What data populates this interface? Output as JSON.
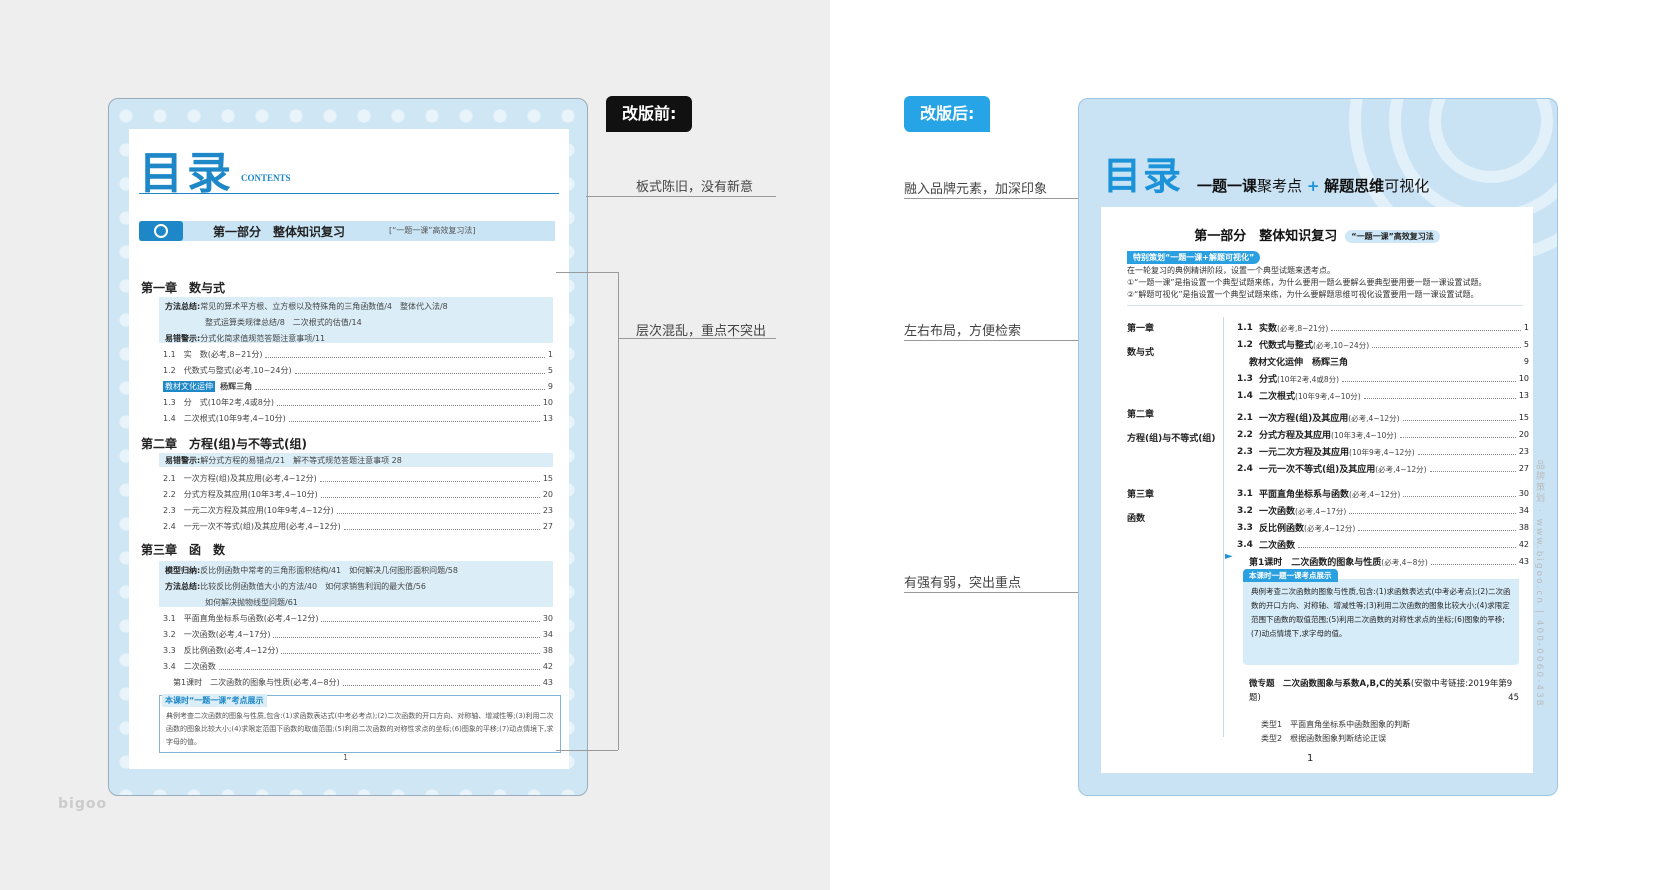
{
  "before": {
    "bubble": "改版前:",
    "notes": [
      "板式陈旧，没有新意",
      "层次混乱，重点不突出"
    ],
    "title": "目录",
    "contents": "CONTENTS",
    "part_title": "第一部分　整体知识复习",
    "part_sub": "[“一题一课”高效复习法]",
    "ch1": {
      "title": "第一章　数与式",
      "lines": [
        {
          "label": "方法总结:",
          "text": "常见的算术平方根、立方根以及特殊角的三角函数值/4　整体代入法/8"
        },
        {
          "label": "",
          "text": "整式运算类规律总结/8　二次根式的估值/14"
        },
        {
          "label": "易错警示:",
          "text": "分式化简求值规范答题注意事项/11"
        }
      ],
      "entries": [
        {
          "t": "1.1　实　数(必考,8~21分)",
          "p": "1"
        },
        {
          "t": "1.2　代数式与整式(必考,10~24分)",
          "p": "5"
        },
        {
          "t": "教材文化运伸",
          "hl": true,
          "extra": "杨辉三角",
          "p": "9"
        },
        {
          "t": "1.3　分　式(10年2考,4或8分)",
          "p": "10"
        },
        {
          "t": "1.4　二次根式(10年9考,4~10分)",
          "p": "13"
        }
      ]
    },
    "ch2": {
      "title": "第二章　方程(组)与不等式(组)",
      "lines": [
        {
          "label": "易错警示:",
          "text": "解分式方程的易错点/21　解不等式规范答题注意事项 28"
        }
      ],
      "entries": [
        {
          "t": "2.1　一次方程(组)及其应用(必考,4~12分)",
          "p": "15"
        },
        {
          "t": "2.2　分式方程及其应用(10年3考,4~10分)",
          "p": "20"
        },
        {
          "t": "2.3　一元二次方程及其应用(10年9考,4~12分)",
          "p": "23"
        },
        {
          "t": "2.4　一元一次不等式(组)及其应用(必考,4~12分)",
          "p": "27"
        }
      ]
    },
    "ch3": {
      "title": "第三章　函　数",
      "lines": [
        {
          "label": "模型归纳:",
          "text": "反比例函数中常考的三角形面积结构/41　如何解决几何图形面积问题/58"
        },
        {
          "label": "方法总结:",
          "text": "比较反比例函数值大小的方法/40　如何求销售利润的最大值/56"
        },
        {
          "label": "",
          "text": "如何解决抛物线型问题/61"
        }
      ],
      "entries": [
        {
          "t": "3.1　平面直角坐标系与函数(必考,4~12分)",
          "p": "30"
        },
        {
          "t": "3.2　一次函数(必考,4~17分)",
          "p": "34"
        },
        {
          "t": "3.3　反比例函数(必考,4~12分)",
          "p": "38"
        },
        {
          "t": "3.4　二次函数",
          "p": "42"
        },
        {
          "t": "第1课时　二次函数的图象与性质(必考,4~8分)",
          "p": "43"
        }
      ]
    },
    "box_tag": "本课时“一题一课”考点展示",
    "box_text": "典例考查二次函数的图象与性质,包含:(1)求函数表达式(中考必考点);(2)二次函数的开口方向、对称轴、增减性等;(3)利用二次函数的图象比较大小;(4)求限定范围下函数的取值范围;(5)利用二次函数的对称性求点的坐标;(6)图象的平移;(7)动点情境下,求字母的值。",
    "page": "1"
  },
  "after": {
    "bubble": "改版后:",
    "notes": [
      "融入品牌元素，加深印象",
      "左右布局，方便检索",
      "有强有弱，突出重点"
    ],
    "title": "目录",
    "subtitle_a": "一题一课",
    "subtitle_b": "聚考点",
    "subtitle_plus": "+",
    "subtitle_c": "解题思维",
    "subtitle_d": "可视化",
    "part_title": "第一部分　整体知识复习",
    "part_sub": "“一题一课”高效复习法",
    "tag": "特别策划“一题一课+解题可视化”",
    "intro": [
      "在一轮复习的典例精讲阶段，设置一个典型试题来透考点。",
      "①“一题一课”是指设置一个典型试题来练，为什么要用一题么要解么要典型要用要一题一课设置试题。",
      "②“解题可视化”是指设置一个典型试题来练，为什么要解题思维可视化设置要用一题一课设置试题。"
    ],
    "chapters": [
      {
        "label": "第一章",
        "name": "数与式"
      },
      {
        "label": "第二章",
        "name": "方程(组)与不等式(组)"
      },
      {
        "label": "第三章",
        "name": "函数"
      }
    ],
    "entries": [
      {
        "n": "1.1",
        "t": "实数",
        "s": "(必考,8~21分)",
        "p": "1"
      },
      {
        "n": "1.2",
        "t": "代数式与整式",
        "s": "(必考,10~24分)",
        "p": "5"
      },
      {
        "n": "",
        "t": "教材文化运伸　杨辉三角",
        "s": "",
        "p": "9"
      },
      {
        "n": "1.3",
        "t": "分式",
        "s": "(10年2考,4或8分)",
        "p": "10"
      },
      {
        "n": "1.4",
        "t": "二次根式",
        "s": "(10年9考,4~10分)",
        "p": "13"
      },
      {
        "n": "2.1",
        "t": "一次方程(组)及其应用",
        "s": "(必考,4~12分)",
        "p": "15"
      },
      {
        "n": "2.2",
        "t": "分式方程及其应用",
        "s": "(10年3考,4~10分)",
        "p": "20"
      },
      {
        "n": "2.3",
        "t": "一元二次方程及其应用",
        "s": "(10年9考,4~12分)",
        "p": "23"
      },
      {
        "n": "2.4",
        "t": "一元一次不等式(组)及其应用",
        "s": "(必考,4~12分)",
        "p": "27"
      },
      {
        "n": "3.1",
        "t": "平面直角坐标系与函数",
        "s": "(必考,4~12分)",
        "p": "30"
      },
      {
        "n": "3.2",
        "t": "一次函数",
        "s": "(必考,4~17分)",
        "p": "34"
      },
      {
        "n": "3.3",
        "t": "反比例函数",
        "s": "(必考,4~12分)",
        "p": "38"
      },
      {
        "n": "3.4",
        "t": "二次函数",
        "s": "",
        "p": "42"
      },
      {
        "n": "",
        "t": "第1课时　二次函数的图象与性质",
        "s": "(必考,4~8分)",
        "p": "43"
      }
    ],
    "box_tag": "本课时一题一课考点展示",
    "box_text": "典例考查二次函数的图象与性质,包含:(1)求函数表达式(中考必考点);(2)二次函数的开口方向、对称轴、增减性等;(3)利用二次函数的图象比较大小;(4)求限定范围下函数的取值范围;(5)利用二次函数的对称性求点的坐标;(6)图象的平移;(7)动点情境下,求字母的值。",
    "special_label": "微专题　二次函数图象与系数A,B,C的关系",
    "special_sub": "(安徽中考链接:2019年第9题)",
    "special_page": "45",
    "types": [
      "类型1　平面直角坐标系中函数图象的判断",
      "类型2　根据函数图象判断结论正误"
    ],
    "page": "1"
  },
  "watermark": "品牌策划 · www.bigoo.cn | 400-0060-438",
  "logo": "bigoo"
}
